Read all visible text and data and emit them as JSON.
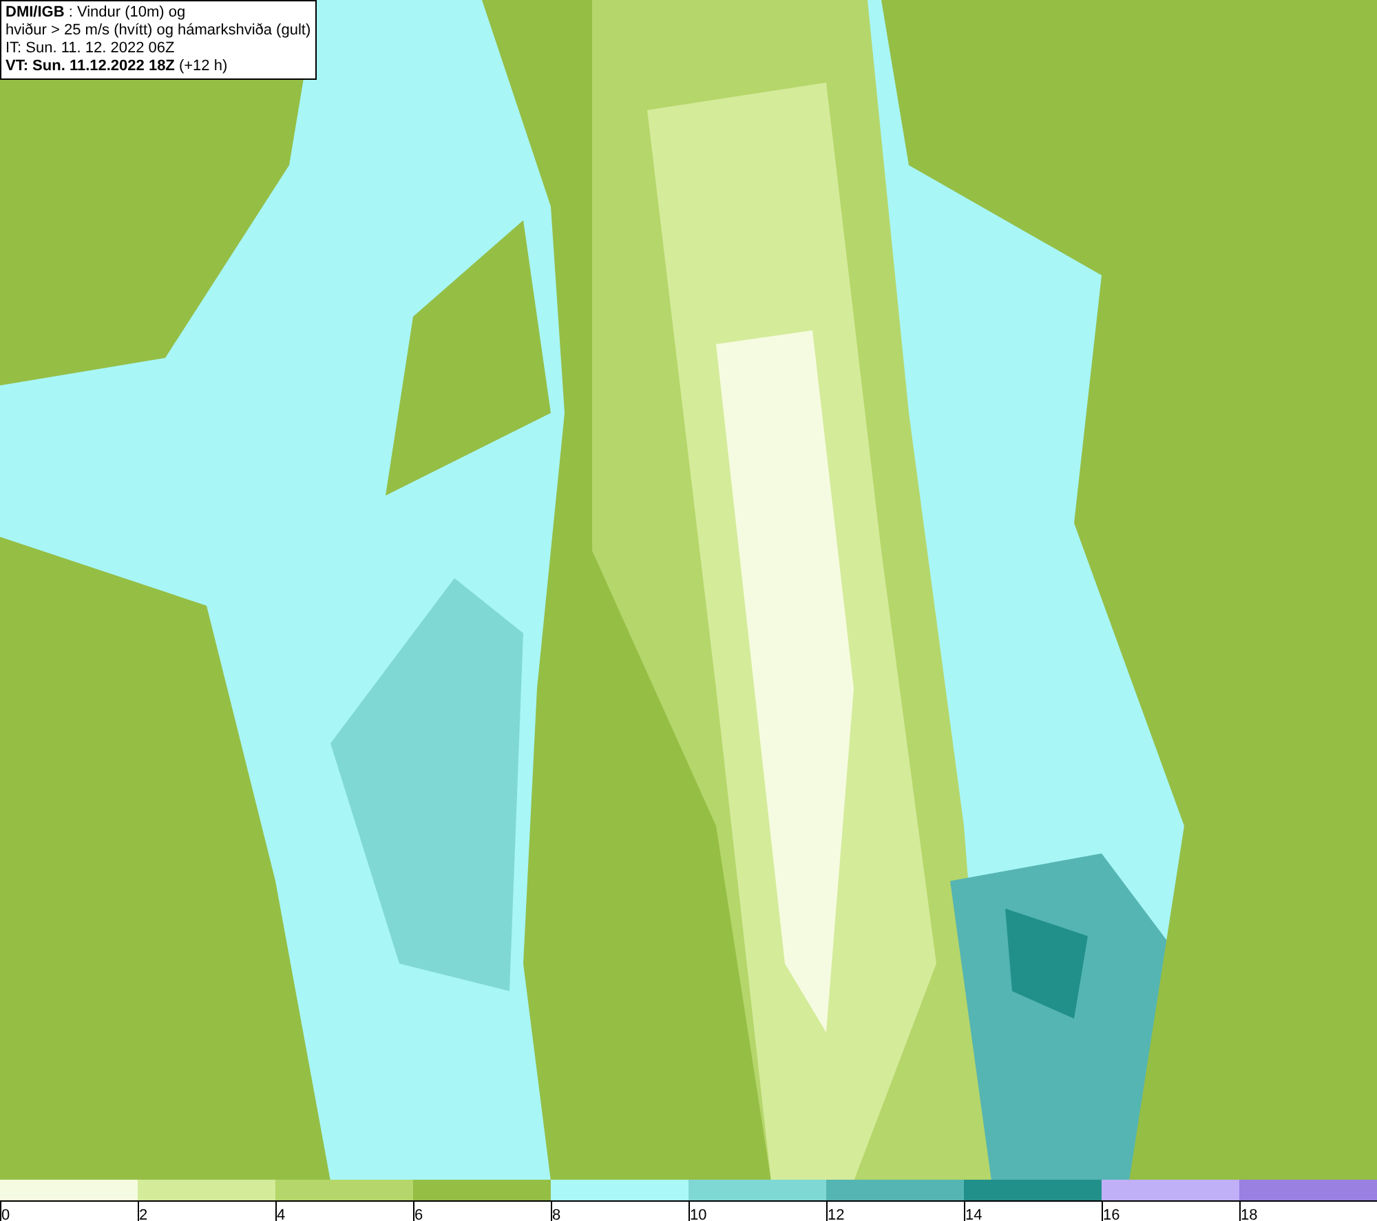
{
  "header": {
    "lines": [
      "**DMI/IGB** : Vindur (10m) og",
      "hviður > 25 m/s (hvítt) og hámarkshviða (gult)",
      "IT: Sun. 11. 12. 2022 06Z",
      "**VT: Sun. 11.12.2022 18Z** (+12 h)"
    ]
  },
  "legend": {
    "bins": [
      {
        "label": "0",
        "color": "#f5fbe0"
      },
      {
        "label": "2",
        "color": "#d4eb9a"
      },
      {
        "label": "4",
        "color": "#b5d66a"
      },
      {
        "label": "6",
        "color": "#95be45"
      },
      {
        "label": "8",
        "color": "#aaf8f8"
      },
      {
        "label": "10",
        "color": "#80d8d4"
      },
      {
        "label": "12",
        "color": "#55b5b2"
      },
      {
        "label": "14",
        "color": "#22908a"
      },
      {
        "label": "16",
        "color": "#c0b0f8"
      },
      {
        "label": "18",
        "color": "#9a80e0"
      }
    ]
  }
}
